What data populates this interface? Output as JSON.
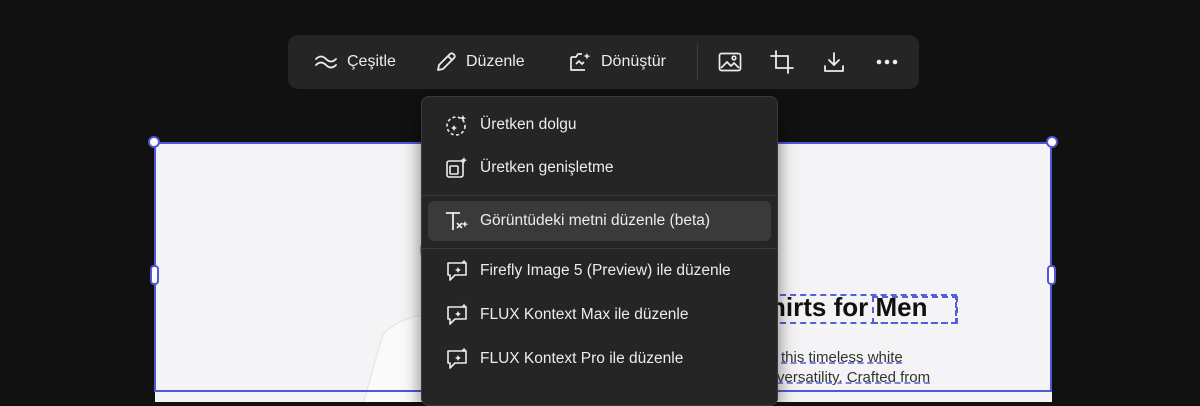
{
  "toolbar": {
    "vary_label": "Çeşitle",
    "edit_label": "Düzenle",
    "transform_label": "Dönüştür",
    "icons": [
      "image-icon",
      "crop-icon",
      "download-icon",
      "more-icon"
    ]
  },
  "menu": {
    "items": [
      {
        "label": "Üretken dolgu",
        "icon": "generative-fill-icon"
      },
      {
        "label": "Üretken genişletme",
        "icon": "generative-expand-icon"
      },
      {
        "label": "Görüntüdeki metni düzenle (beta)",
        "icon": "edit-text-icon",
        "active": true
      },
      {
        "label": "Firefly Image 5 (Preview) ile düzenle",
        "icon": "chat-edit-icon"
      },
      {
        "label": "FLUX Kontext Max ile düzenle",
        "icon": "chat-edit-icon"
      },
      {
        "label": "FLUX Kontext Pro ile düzenle",
        "icon": "chat-edit-icon"
      }
    ]
  },
  "canvas": {
    "headline_fragment": "hirts for Men",
    "body_line_1": "this timeless white",
    "body_line_2": "versatility. Crafted from"
  },
  "colors": {
    "background": "#111111",
    "panel": "#252525",
    "selection": "#4f58d8",
    "text_box_dash": "#5560d6"
  }
}
